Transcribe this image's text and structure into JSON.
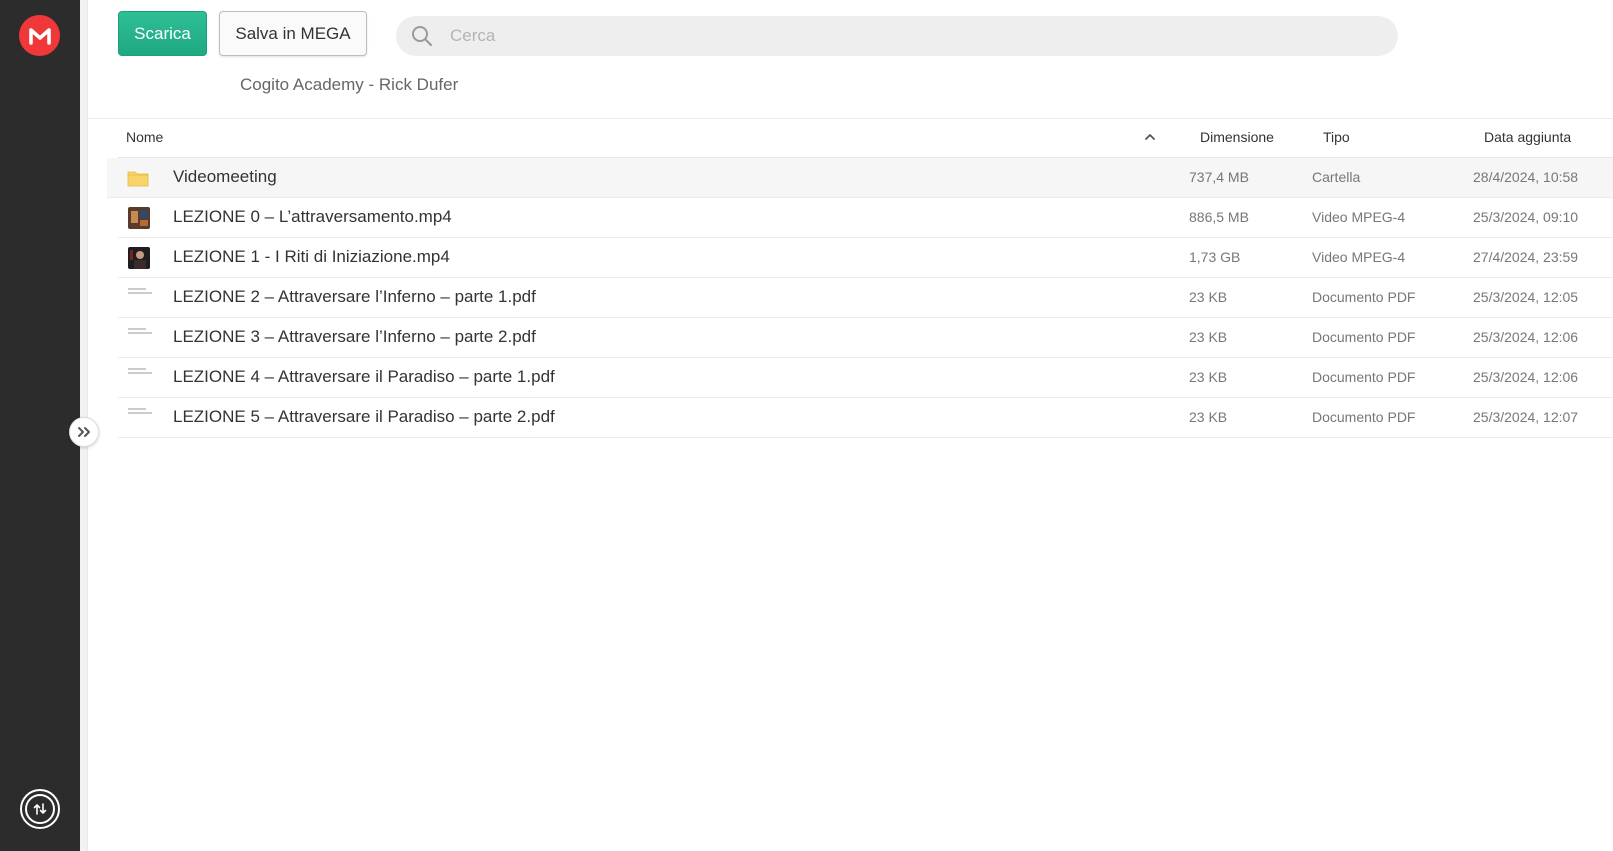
{
  "header": {
    "download_label": "Scarica",
    "save_label": "Salva in MEGA",
    "search_placeholder": "Cerca",
    "breadcrumb": "Cogito Academy - Rick Dufer"
  },
  "columns": {
    "name": "Nome",
    "size": "Dimensione",
    "type": "Tipo",
    "date": "Data aggiunta"
  },
  "files": [
    {
      "name": "Videomeeting",
      "size": "737,4 MB",
      "type": "Cartella",
      "date": "28/4/2024, 10:58",
      "icon": "folder-icon"
    },
    {
      "name": "LEZIONE 0 – L’attraversamento.mp4",
      "size": "886,5 MB",
      "type": "Video MPEG-4",
      "date": "25/3/2024, 09:10",
      "icon": "video-thumbnail"
    },
    {
      "name": "LEZIONE 1 - I Riti di Iniziazione.mp4",
      "size": "1,73 GB",
      "type": "Video MPEG-4",
      "date": "27/4/2024, 23:59",
      "icon": "video-thumbnail"
    },
    {
      "name": "LEZIONE 2 – Attraversare l’Inferno – parte 1.pdf",
      "size": "23 KB",
      "type": "Documento PDF",
      "date": "25/3/2024, 12:05",
      "icon": "pdf-thumbnail"
    },
    {
      "name": "LEZIONE 3 – Attraversare l’Inferno – parte 2.pdf",
      "size": "23 KB",
      "type": "Documento PDF",
      "date": "25/3/2024, 12:06",
      "icon": "pdf-thumbnail"
    },
    {
      "name": "LEZIONE 4 – Attraversare il Paradiso – parte 1.pdf",
      "size": "23 KB",
      "type": "Documento PDF",
      "date": "25/3/2024, 12:06",
      "icon": "pdf-thumbnail"
    },
    {
      "name": "LEZIONE 5 – Attraversare il Paradiso – parte 2.pdf",
      "size": "23 KB",
      "type": "Documento PDF",
      "date": "25/3/2024, 12:07",
      "icon": "pdf-thumbnail"
    }
  ],
  "colors": {
    "brand_red": "#f0373a",
    "download_green": "#1fa882",
    "rail_dark": "#2c2c2c",
    "folder_yellow": "#f7d56b"
  }
}
